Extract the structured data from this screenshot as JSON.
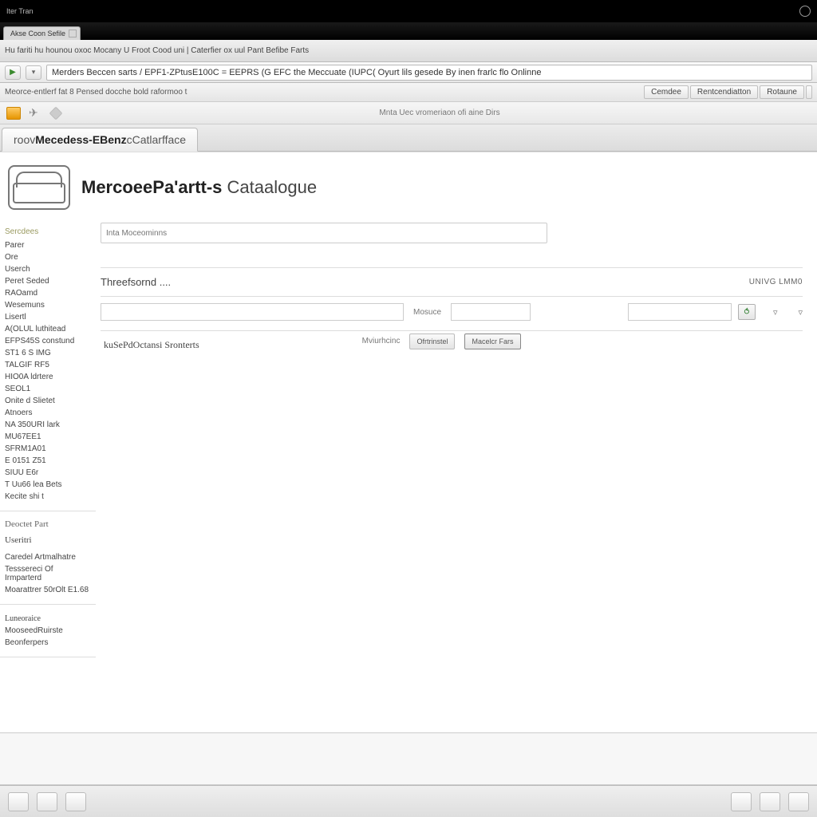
{
  "window": {
    "title": "Iter Tran"
  },
  "browser_tab": {
    "label": "Akse Coon Sefile"
  },
  "menubar": {
    "text": "Hu fariti hu hounou oxoc Mocany U Froot Cood uni | Caterfier ox uul Pant Befibe Farts"
  },
  "address": {
    "text": "Merders Beccen sarts / EPF1-ZPtusE100C = EEPRS (G EFC the Meccuate (IUPC( Oyurt lils gesede By inen frarlc flo Onlinne"
  },
  "bookmarkbar": {
    "text": "Meorce-entlerf fat 8 Pensed docche bold raformoo t",
    "buttons": [
      "Cemdee",
      "Rentcendiatton",
      "Rotaune"
    ]
  },
  "toolbar2": {
    "center": "Mnta Uec vromeriaon ofi aine Dirs"
  },
  "page_tab": {
    "prefix": "roov",
    "brand": "Mecedess-EBenz",
    "suffix": "cCatlarfface"
  },
  "page_title": {
    "main": "MercoeePa'artt-s ",
    "suffix": "Cataalogue"
  },
  "search": {
    "placeholder": "Inta Moceominns"
  },
  "sidebar": {
    "heading1": "Sercdees",
    "items": [
      "Parer",
      "Ore",
      "Userch",
      "Peret Seded",
      "RAOamd",
      "Wesemuns",
      "Lisertl",
      "A(OLUL luthitead",
      "EFPS45S constund",
      "ST1 6 S IMG",
      "TALGIF RF5",
      "HIO0A ldrtere",
      "SEOL1",
      "Onite d Slietet",
      "Atnoers",
      "NA 350URI lark",
      "MU67EE1",
      "SFRM1A01",
      "E 0151 Z51",
      "SIUU E6r",
      "T Uu66 lea Bets",
      "Kecite shi t"
    ],
    "heading2": "Deoctet Part",
    "item_user": "Useritri",
    "sub_items": [
      "Caredel Artmalhatre",
      "Tesssereci Of Irmparterd",
      "Moarattrer 50rOlt E1.68"
    ],
    "heading3": "Luneoraice",
    "sub_items2": [
      "MooseedRuirste",
      "Beonferpers"
    ]
  },
  "panel": {
    "threshold": "Threefsornd ....",
    "unvalme": "UNIVG LMM0",
    "measure_label": "Mosuce",
    "row2_label": "kuSePdOctansi Sronterts",
    "row2_mid": "Mviurhcinc",
    "btn1": "Ofrtrinstel",
    "btn2": "Macelcr Fars"
  }
}
